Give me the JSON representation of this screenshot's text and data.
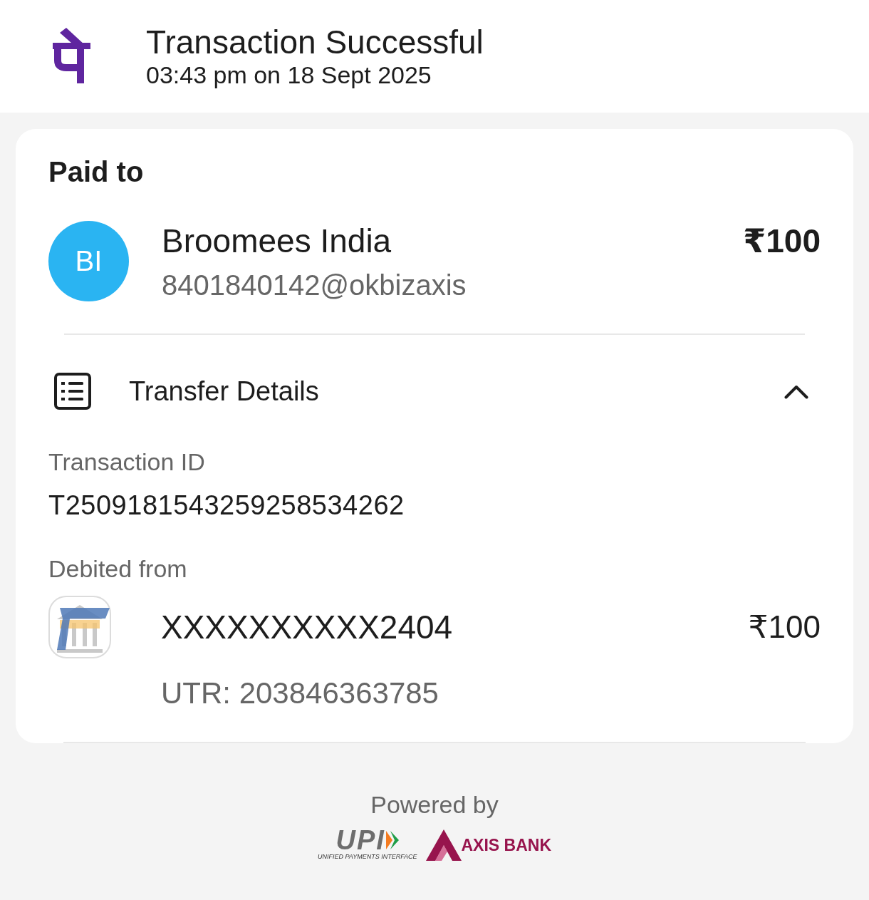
{
  "header": {
    "title": "Transaction Successful",
    "subtitle": "03:43 pm on 18 Sept 2025"
  },
  "paid_to": {
    "heading": "Paid to",
    "avatar_initials": "BI",
    "name": "Broomees India",
    "vpa": "8401840142@okbizaxis",
    "amount": "₹100"
  },
  "transfer_details": {
    "title": "Transfer Details",
    "expanded": true,
    "fields": [
      {
        "label": "Transaction ID",
        "value": "T2509181543259258534262"
      }
    ],
    "debited_from": {
      "label": "Debited from",
      "account": "XXXXXXXXXX2404",
      "amount": "₹100",
      "utr": "UTR: 203846363785"
    }
  },
  "footer": {
    "powered_by": "Powered by",
    "upi": {
      "mark": "UPI",
      "tagline": "UNIFIED PAYMENTS INTERFACE"
    },
    "bank": "AXIS BANK"
  }
}
